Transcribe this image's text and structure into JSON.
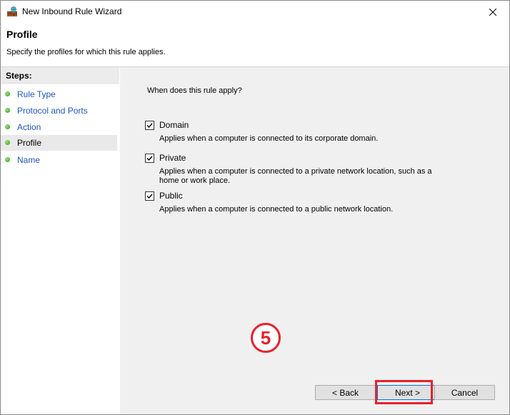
{
  "window": {
    "title": "New Inbound Rule Wizard"
  },
  "header": {
    "title": "Profile",
    "description": "Specify the profiles for which this rule applies."
  },
  "steps": {
    "heading": "Steps:",
    "items": [
      {
        "label": "Rule Type"
      },
      {
        "label": "Protocol and Ports"
      },
      {
        "label": "Action"
      },
      {
        "label": "Profile"
      },
      {
        "label": "Name"
      }
    ],
    "current_index": 3
  },
  "content": {
    "question": "When does this rule apply?",
    "options": [
      {
        "label": "Domain",
        "checked": true,
        "description": "Applies when a computer is connected to its corporate domain."
      },
      {
        "label": "Private",
        "checked": true,
        "description": "Applies when a computer is connected to a private network location, such as a home or work place."
      },
      {
        "label": "Public",
        "checked": true,
        "description": "Applies when a computer is connected to a public network location."
      }
    ]
  },
  "annotation": {
    "step_number": "5",
    "color": "#e8202a"
  },
  "buttons": {
    "back": "< Back",
    "next": "Next >",
    "cancel": "Cancel"
  }
}
